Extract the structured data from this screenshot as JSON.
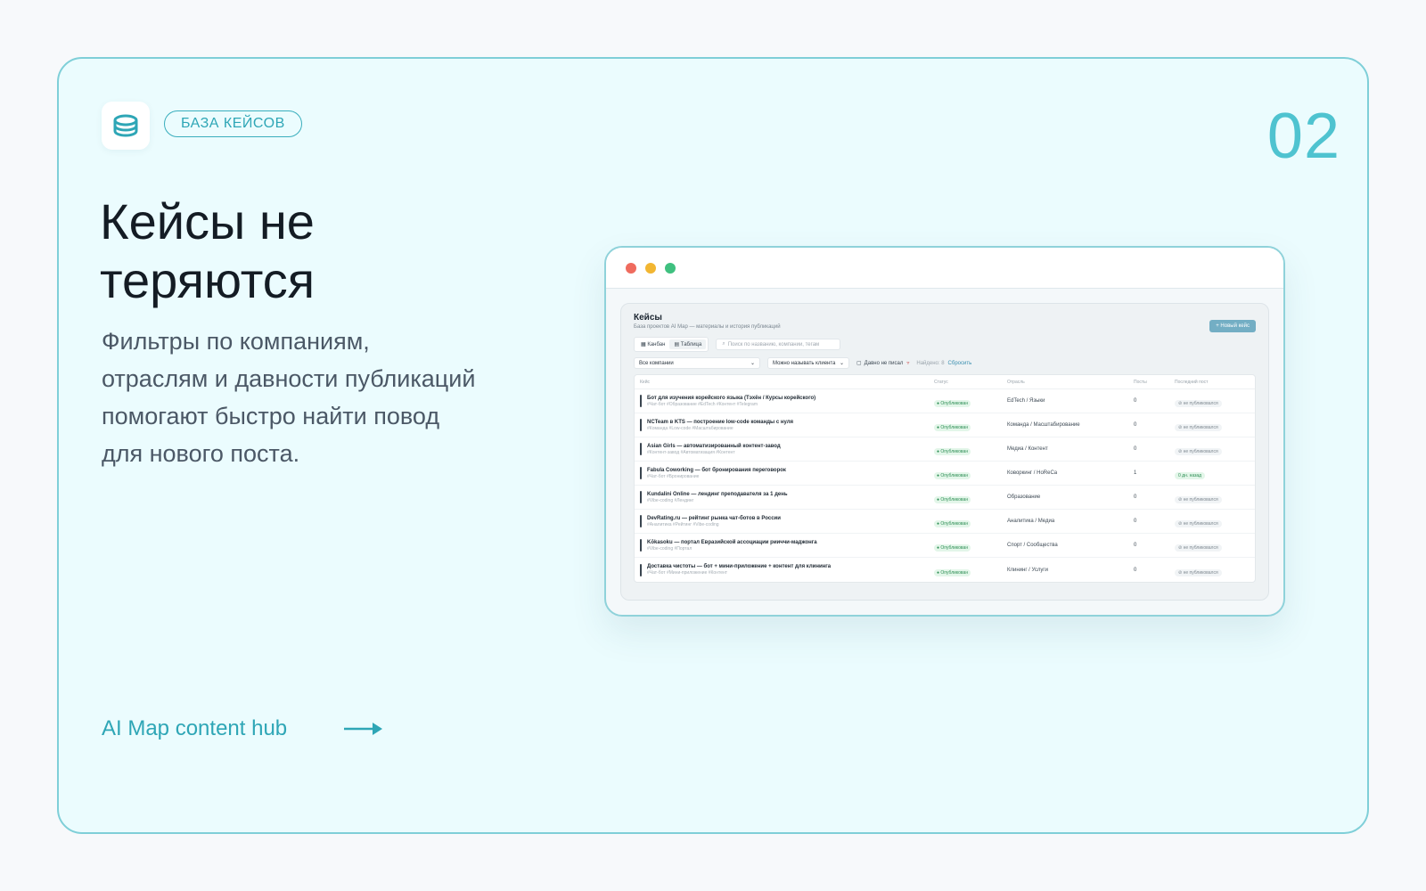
{
  "slide": {
    "tag": "БАЗА КЕЙСОВ",
    "number": "02",
    "headline_line1": "Кейсы не",
    "headline_line2": "теряются",
    "subtext": "Фильтры по компаниям, отраслям и давности публикаций помогают быстро найти повод для нового поста.",
    "footer_link": "AI Map content hub",
    "logo_icon": "database-icon",
    "accent_color": "#4fc3d0",
    "text_accent_color": "#2ea6b6"
  },
  "app": {
    "window_dots": [
      "#ef6b5e",
      "#f2b632",
      "#3fc07f"
    ],
    "title": "Кейсы",
    "subtitle": "База проектов AI Map — материалы и история публикаций",
    "new_button": "+ Новый кейс",
    "views": [
      "Канбан",
      "Таблица"
    ],
    "search_placeholder": "Поиск по названию, компании, тегам",
    "filter_company": "Все компании",
    "filter_client": "Можно называть клиента",
    "filter_stale": "Давно не писал",
    "found_label": "Найдено: 8",
    "reset_label": "Сбросить",
    "columns": [
      "Кейс",
      "Статус",
      "Отрасль",
      "Посты",
      "Последний пост"
    ],
    "rows": [
      {
        "title": "Бот для изучения корейского языка (Тэхён / Курсы корейского)",
        "tags": "#Чат-бот #Образование #EdTech #Контент #Telegram",
        "status": "● Опубликован",
        "industry": "EdTech / Языки",
        "posts": "0",
        "last": "⊘ не публиковался"
      },
      {
        "title": "NCTeam в KTS — построение low-code команды с нуля",
        "tags": "#Команда #Low-code #Масштабирование",
        "status": "● Опубликован",
        "industry": "Команда / Масштабирование",
        "posts": "0",
        "last": "⊘ не публиковался"
      },
      {
        "title": "Asian Girls — автоматизированный контент-завод",
        "tags": "#Контент-завод #Автоматизация #Контент",
        "status": "● Опубликован",
        "industry": "Медиа / Контент",
        "posts": "0",
        "last": "⊘ не публиковался"
      },
      {
        "title": "Fabula Coworking — бот бронирования переговорок",
        "tags": "#Чат-бот #Бронирование",
        "status": "● Опубликован",
        "industry": "Коворкинг / HoReCa",
        "posts": "1",
        "last": "0 дн. назад"
      },
      {
        "title": "Kundalini Online — лендинг преподавателя за 1 день",
        "tags": "#Vibe-coding #Лендинг",
        "status": "● Опубликован",
        "industry": "Образование",
        "posts": "0",
        "last": "⊘ не публиковался"
      },
      {
        "title": "DevRating.ru — рейтинг рынка чат-ботов в России",
        "tags": "#Аналитика #Рейтинг #Vibe-coding",
        "status": "● Опубликован",
        "industry": "Аналитика / Медиа",
        "posts": "0",
        "last": "⊘ не публиковался"
      },
      {
        "title": "Kōkasoku — портал Евразийской ассоциации рииччи-маджонга",
        "tags": "#Vibe-coding #Портал",
        "status": "● Опубликован",
        "industry": "Спорт / Сообщества",
        "posts": "0",
        "last": "⊘ не публиковался"
      },
      {
        "title": "Доставка чистоты — бот + мини-приложение + контент для клининга",
        "tags": "#Чат-бот #Мини-приложение #Контент",
        "status": "● Опубликован",
        "industry": "Клининг / Услуги",
        "posts": "0",
        "last": "⊘ не публиковался"
      }
    ]
  }
}
